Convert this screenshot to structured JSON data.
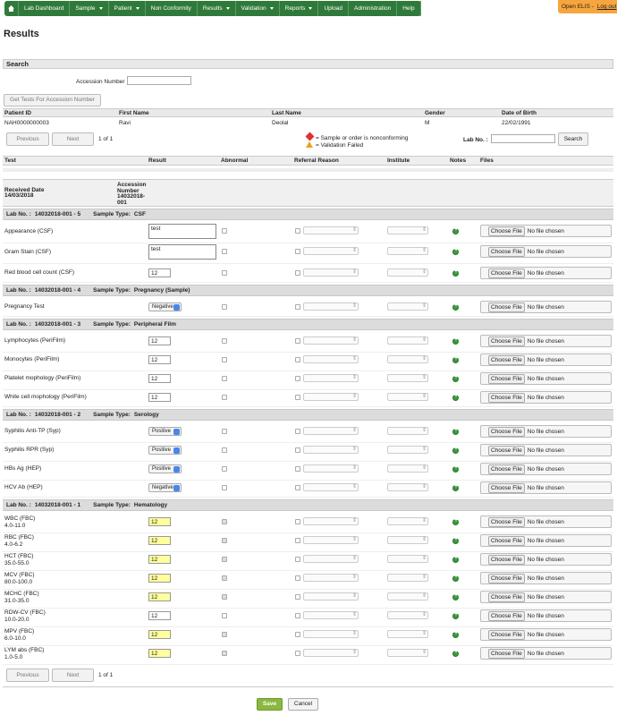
{
  "nav": {
    "items": [
      {
        "label": "Lab Dashboard",
        "caret": false
      },
      {
        "label": "Sample",
        "caret": true
      },
      {
        "label": "Patient",
        "caret": true
      },
      {
        "label": "Non Conformity",
        "caret": false
      },
      {
        "label": "Results",
        "caret": true
      },
      {
        "label": "Validation",
        "caret": true
      },
      {
        "label": "Reports",
        "caret": true
      },
      {
        "label": "Upload",
        "caret": false
      },
      {
        "label": "Administration",
        "caret": false
      },
      {
        "label": "Help",
        "caret": false
      }
    ],
    "app_name": "Open ELIS -",
    "logout": "Log out"
  },
  "page_title": "Results",
  "search": {
    "title": "Search",
    "accession_label": "Accession Number",
    "accession_value": "",
    "get_tests_button": "Get Tests For Accession Number"
  },
  "patient": {
    "headers": [
      "Patient ID",
      "First Name",
      "Last Name",
      "Gender",
      "Date of Birth"
    ],
    "values": [
      "NAH0000000003",
      "Ravi",
      "Deolal",
      "M",
      "22/02/1991"
    ]
  },
  "pager": {
    "previous": "Previous",
    "next": "Next",
    "page_info": "1 of 1"
  },
  "legend": {
    "nonconforming": "= Sample or order is nonconforming",
    "validation_failed": "= Validation Failed"
  },
  "lab_no_search": {
    "label": "Lab No. :",
    "value": "",
    "button": "Search"
  },
  "columns": [
    "Test",
    "Result",
    "Abnormal",
    "Referral Reason",
    "Institute",
    "Notes",
    "Files"
  ],
  "order_info": {
    "received_label": "Received Date",
    "received_date": "14/03/2018",
    "accession_label": "Accession Number",
    "accession_number": "14032018-001"
  },
  "file_input": {
    "button": "Choose File",
    "status": "No file chosen"
  },
  "sections": [
    {
      "lab_no_label": "Lab No. :",
      "lab_no": "14032018-001 - 5",
      "sample_type_label": "Sample Type:",
      "sample_type": "CSF",
      "tests": [
        {
          "name": "Appearance (CSF)",
          "range": "",
          "kind": "textarea",
          "value": "test",
          "abnormal": false
        },
        {
          "name": "Gram Stain (CSF)",
          "range": "",
          "kind": "textarea",
          "value": "test",
          "abnormal": false
        },
        {
          "name": "Red blood cell count (CSF)",
          "range": "",
          "kind": "text",
          "value": "12",
          "abnormal": false
        }
      ]
    },
    {
      "lab_no_label": "Lab No. :",
      "lab_no": "14032018-001 - 4",
      "sample_type_label": "Sample Type:",
      "sample_type": "Pregnancy (Sample)",
      "tests": [
        {
          "name": "Pregnancy Test",
          "range": "",
          "kind": "select",
          "value": "Negative",
          "abnormal": false
        }
      ]
    },
    {
      "lab_no_label": "Lab No. :",
      "lab_no": "14032018-001 - 3",
      "sample_type_label": "Sample Type:",
      "sample_type": "Peripheral Film",
      "tests": [
        {
          "name": "Lymphocytes (PeriFilm)",
          "range": "",
          "kind": "text",
          "value": "12",
          "abnormal": false
        },
        {
          "name": "Monocytes (PeriFilm)",
          "range": "",
          "kind": "text",
          "value": "12",
          "abnormal": false
        },
        {
          "name": "Platelet mophology (PeriFilm)",
          "range": "",
          "kind": "text",
          "value": "12",
          "abnormal": false
        },
        {
          "name": "White cell mophology (PeriFilm)",
          "range": "",
          "kind": "text",
          "value": "12",
          "abnormal": false
        }
      ]
    },
    {
      "lab_no_label": "Lab No. :",
      "lab_no": "14032018-001 - 2",
      "sample_type_label": "Sample Type:",
      "sample_type": "Serology",
      "tests": [
        {
          "name": "Syphilis Anti-TP (Syp)",
          "range": "",
          "kind": "select",
          "value": "Positive",
          "abnormal": false
        },
        {
          "name": "Syphilis RPR (Syp)",
          "range": "",
          "kind": "select",
          "value": "Positive",
          "abnormal": false
        },
        {
          "name": "HBs Ag (HEP)",
          "range": "",
          "kind": "select",
          "value": "Positive",
          "abnormal": false
        },
        {
          "name": "HCV Ab (HEP)",
          "range": "",
          "kind": "select",
          "value": "Negative",
          "abnormal": false
        }
      ]
    },
    {
      "lab_no_label": "Lab No. :",
      "lab_no": "14032018-001 - 1",
      "sample_type_label": "Sample Type:",
      "sample_type": "Hematology",
      "tests": [
        {
          "name": "WBC (FBC)",
          "range": "4.0-11.0",
          "kind": "text",
          "value": "12",
          "abnormal": true
        },
        {
          "name": "RBC (FBC)",
          "range": "4.0-6.2",
          "kind": "text",
          "value": "12",
          "abnormal": true
        },
        {
          "name": "HCT (FBC)",
          "range": "35.0-55.0",
          "kind": "text",
          "value": "12",
          "abnormal": true
        },
        {
          "name": "MCV (FBC)",
          "range": "80.0-100.0",
          "kind": "text",
          "value": "12",
          "abnormal": true
        },
        {
          "name": "MCHC (FBC)",
          "range": "31.0-35.0",
          "kind": "text",
          "value": "12",
          "abnormal": true
        },
        {
          "name": "RDW-CV (FBC)",
          "range": "10.0-20.0",
          "kind": "text",
          "value": "12",
          "abnormal": false
        },
        {
          "name": "MPV (FBC)",
          "range": "6.0-10.0",
          "kind": "text",
          "value": "12",
          "abnormal": true
        },
        {
          "name": "LYM abs (FBC)",
          "range": "1.0-5.0",
          "kind": "text",
          "value": "12",
          "abnormal": true
        }
      ]
    }
  ],
  "actions": {
    "save": "Save",
    "cancel": "Cancel"
  },
  "colors": {
    "nav": "#2f7a3a",
    "accent": "#f7a63d",
    "save": "#8ab840",
    "abnormal_field": "#ffff9d"
  }
}
